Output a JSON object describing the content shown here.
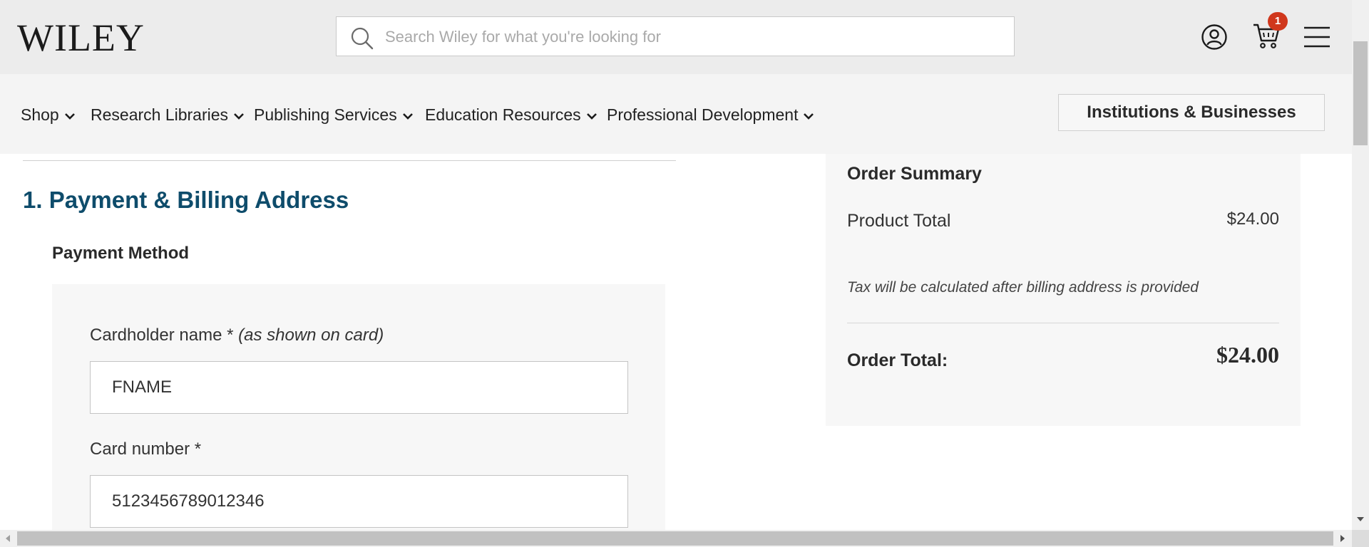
{
  "header": {
    "logo": "WILEY",
    "search": {
      "placeholder": "Search Wiley for what you're looking for",
      "value": ""
    },
    "icons": {
      "search": "search-icon",
      "account": "account-circle-icon",
      "cart": "shopping-cart-icon",
      "menu": "hamburger-menu-icon"
    },
    "cart_count": "1"
  },
  "nav": {
    "items": [
      {
        "label": "Shop"
      },
      {
        "label": "Research Libraries"
      },
      {
        "label": "Publishing Services"
      },
      {
        "label": "Education Resources"
      },
      {
        "label": "Professional Development"
      }
    ],
    "institutions_button": "Institutions & Businesses"
  },
  "checkout": {
    "section_title": "1. Payment & Billing Address",
    "payment_method_label": "Payment Method",
    "cardholder": {
      "label": "Cardholder name *",
      "hint": "(as shown on card)",
      "value": "FNAME"
    },
    "card_number": {
      "label": "Card number *",
      "value": "5123456789012346"
    }
  },
  "summary": {
    "title": "Order Summary",
    "product_total_label": "Product Total",
    "product_total_value": "$24.00",
    "tax_note": "Tax will be calculated after billing address is provided",
    "order_total_label": "Order Total:",
    "order_total_value": "$24.00"
  },
  "colors": {
    "accent": "#0e4c6b",
    "badge": "#d0371c",
    "header_bg": "#ececec",
    "nav_bg": "#f4f4f4",
    "panel_bg": "#f7f7f7"
  }
}
